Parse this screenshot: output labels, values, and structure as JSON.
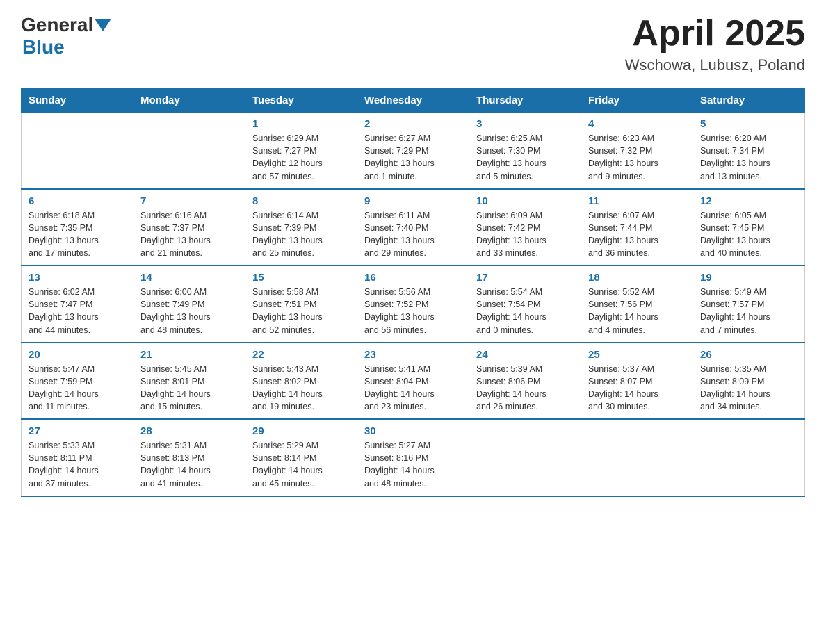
{
  "header": {
    "logo_general": "General",
    "logo_blue": "Blue",
    "month_title": "April 2025",
    "location": "Wschowa, Lubusz, Poland"
  },
  "days_of_week": [
    "Sunday",
    "Monday",
    "Tuesday",
    "Wednesday",
    "Thursday",
    "Friday",
    "Saturday"
  ],
  "weeks": [
    [
      {
        "num": "",
        "info": ""
      },
      {
        "num": "",
        "info": ""
      },
      {
        "num": "1",
        "info": "Sunrise: 6:29 AM\nSunset: 7:27 PM\nDaylight: 12 hours\nand 57 minutes."
      },
      {
        "num": "2",
        "info": "Sunrise: 6:27 AM\nSunset: 7:29 PM\nDaylight: 13 hours\nand 1 minute."
      },
      {
        "num": "3",
        "info": "Sunrise: 6:25 AM\nSunset: 7:30 PM\nDaylight: 13 hours\nand 5 minutes."
      },
      {
        "num": "4",
        "info": "Sunrise: 6:23 AM\nSunset: 7:32 PM\nDaylight: 13 hours\nand 9 minutes."
      },
      {
        "num": "5",
        "info": "Sunrise: 6:20 AM\nSunset: 7:34 PM\nDaylight: 13 hours\nand 13 minutes."
      }
    ],
    [
      {
        "num": "6",
        "info": "Sunrise: 6:18 AM\nSunset: 7:35 PM\nDaylight: 13 hours\nand 17 minutes."
      },
      {
        "num": "7",
        "info": "Sunrise: 6:16 AM\nSunset: 7:37 PM\nDaylight: 13 hours\nand 21 minutes."
      },
      {
        "num": "8",
        "info": "Sunrise: 6:14 AM\nSunset: 7:39 PM\nDaylight: 13 hours\nand 25 minutes."
      },
      {
        "num": "9",
        "info": "Sunrise: 6:11 AM\nSunset: 7:40 PM\nDaylight: 13 hours\nand 29 minutes."
      },
      {
        "num": "10",
        "info": "Sunrise: 6:09 AM\nSunset: 7:42 PM\nDaylight: 13 hours\nand 33 minutes."
      },
      {
        "num": "11",
        "info": "Sunrise: 6:07 AM\nSunset: 7:44 PM\nDaylight: 13 hours\nand 36 minutes."
      },
      {
        "num": "12",
        "info": "Sunrise: 6:05 AM\nSunset: 7:45 PM\nDaylight: 13 hours\nand 40 minutes."
      }
    ],
    [
      {
        "num": "13",
        "info": "Sunrise: 6:02 AM\nSunset: 7:47 PM\nDaylight: 13 hours\nand 44 minutes."
      },
      {
        "num": "14",
        "info": "Sunrise: 6:00 AM\nSunset: 7:49 PM\nDaylight: 13 hours\nand 48 minutes."
      },
      {
        "num": "15",
        "info": "Sunrise: 5:58 AM\nSunset: 7:51 PM\nDaylight: 13 hours\nand 52 minutes."
      },
      {
        "num": "16",
        "info": "Sunrise: 5:56 AM\nSunset: 7:52 PM\nDaylight: 13 hours\nand 56 minutes."
      },
      {
        "num": "17",
        "info": "Sunrise: 5:54 AM\nSunset: 7:54 PM\nDaylight: 14 hours\nand 0 minutes."
      },
      {
        "num": "18",
        "info": "Sunrise: 5:52 AM\nSunset: 7:56 PM\nDaylight: 14 hours\nand 4 minutes."
      },
      {
        "num": "19",
        "info": "Sunrise: 5:49 AM\nSunset: 7:57 PM\nDaylight: 14 hours\nand 7 minutes."
      }
    ],
    [
      {
        "num": "20",
        "info": "Sunrise: 5:47 AM\nSunset: 7:59 PM\nDaylight: 14 hours\nand 11 minutes."
      },
      {
        "num": "21",
        "info": "Sunrise: 5:45 AM\nSunset: 8:01 PM\nDaylight: 14 hours\nand 15 minutes."
      },
      {
        "num": "22",
        "info": "Sunrise: 5:43 AM\nSunset: 8:02 PM\nDaylight: 14 hours\nand 19 minutes."
      },
      {
        "num": "23",
        "info": "Sunrise: 5:41 AM\nSunset: 8:04 PM\nDaylight: 14 hours\nand 23 minutes."
      },
      {
        "num": "24",
        "info": "Sunrise: 5:39 AM\nSunset: 8:06 PM\nDaylight: 14 hours\nand 26 minutes."
      },
      {
        "num": "25",
        "info": "Sunrise: 5:37 AM\nSunset: 8:07 PM\nDaylight: 14 hours\nand 30 minutes."
      },
      {
        "num": "26",
        "info": "Sunrise: 5:35 AM\nSunset: 8:09 PM\nDaylight: 14 hours\nand 34 minutes."
      }
    ],
    [
      {
        "num": "27",
        "info": "Sunrise: 5:33 AM\nSunset: 8:11 PM\nDaylight: 14 hours\nand 37 minutes."
      },
      {
        "num": "28",
        "info": "Sunrise: 5:31 AM\nSunset: 8:13 PM\nDaylight: 14 hours\nand 41 minutes."
      },
      {
        "num": "29",
        "info": "Sunrise: 5:29 AM\nSunset: 8:14 PM\nDaylight: 14 hours\nand 45 minutes."
      },
      {
        "num": "30",
        "info": "Sunrise: 5:27 AM\nSunset: 8:16 PM\nDaylight: 14 hours\nand 48 minutes."
      },
      {
        "num": "",
        "info": ""
      },
      {
        "num": "",
        "info": ""
      },
      {
        "num": "",
        "info": ""
      }
    ]
  ]
}
